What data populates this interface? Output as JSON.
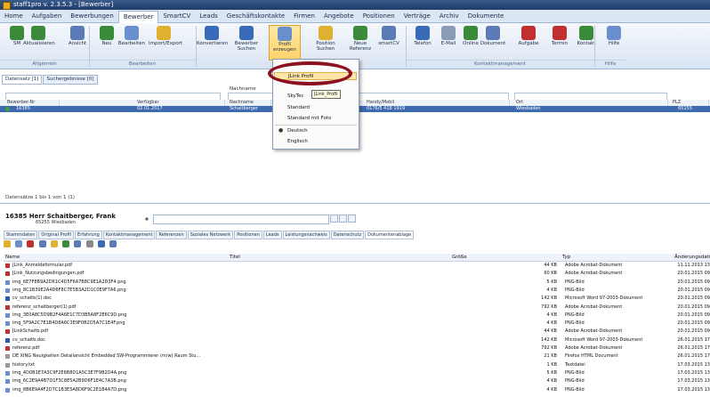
{
  "window": {
    "title": "staff1pro v. 2.3.5.3 - [Bewerber]"
  },
  "menu": [
    "Home",
    "Aufgaben",
    "Bewerbungen",
    "Bewerber",
    "SmartCV",
    "Leads",
    "Geschäftskontakte",
    "Firmen",
    "Angebote",
    "Positionen",
    "Verträge",
    "Archiv",
    "Dokumente"
  ],
  "ribbon": {
    "buttons": [
      "SM",
      "Aktualisieren",
      "Ansicht",
      "Neu",
      "Bearbeiten",
      "Import/Export",
      "Konvertieren",
      "Bewerber Suchen",
      "Profil erzeugen",
      "Position Suchen",
      "Neue Referenz",
      "smartCV",
      "Telefon",
      "E-Mail",
      "Online",
      "Dokument",
      "Aufgabe",
      "Termin",
      "Kontakt",
      "Hilfe"
    ],
    "groups": [
      "Allgemein",
      "Bearbeiten",
      "Kontaktmanagement",
      "Hilfe"
    ]
  },
  "grid": {
    "tabs": [
      "Datensatz [1]",
      "Suchergebnisse [0]"
    ],
    "filter_header": "Nachname",
    "columns": [
      "Bewerber-Nr",
      "Verfügbar",
      "Nachname",
      "Handy/Mobil",
      "Ort",
      "PLZ"
    ],
    "selected_row": [
      "16385",
      "02.01.2017",
      "Schaitberger",
      "0176/5 418 1919",
      "Wiesbaden",
      "65255"
    ],
    "status": "Datensätze 1 bis 1 von 1 (1)"
  },
  "dropdown": {
    "items": [
      "JLink Profil",
      "SkyTec",
      "Standard",
      "Standard mit Foto",
      "Deutsch",
      "Englisch"
    ],
    "tooltip": "JLink_Profil"
  },
  "detail": {
    "name": "16385   Herr Schaitberger, Frank",
    "address": "65255 Wiesbaden",
    "tabs": [
      "Stammdaten",
      "Original Profil",
      "Erfahrung",
      "Kontaktmanagement",
      "Referenzen",
      "Soziales Netzwerk",
      "Positionen",
      "Leads",
      "Leistungsnachweis",
      "Datenschutz",
      "Dokumentenablage"
    ],
    "file_columns": [
      "Name",
      "Titel",
      "Größe",
      "Typ",
      "Änderungsdatum"
    ],
    "files": [
      {
        "name": "JLink_Anmeldeformular.pdf",
        "size": "44 KB",
        "type": "Adobe Acrobat-Dokument",
        "date": "11.11.2013 13"
      },
      {
        "name": "JLink_Nutzungsbedingungen.pdf",
        "size": "60 KB",
        "type": "Adobe Acrobat-Dokument",
        "date": "20.01.2015 09"
      },
      {
        "name": "img_6E7F8B9A2D61C4D5F6A7B8C9E1A2D3F4.png",
        "size": "5 KB",
        "type": "PNG-Bild",
        "date": "20.01.2015 09"
      },
      {
        "name": "img_8C1B39E2A4D6F8C7E5B3A2D1C0E9F7A6.png",
        "size": "4 KB",
        "type": "PNG-Bild",
        "date": "20.01.2015 09"
      },
      {
        "name": "cv_schaitb(1).doc",
        "size": "142 KB",
        "type": "Microsoft Word 97-2003-Dokument",
        "date": "20.01.2015 09"
      },
      {
        "name": "referenz_schaitberger(1).pdf",
        "size": "792 KB",
        "type": "Adobe Acrobat-Dokument",
        "date": "20.01.2015 09"
      },
      {
        "name": "img_3E0A8C5D9B2F4A6E1C7D3B5A8F2E6C9D.png",
        "size": "4 KB",
        "type": "PNG-Bild",
        "date": "20.01.2015 09"
      },
      {
        "name": "img_5F9A2C7E1B4D8A6C3E9F0B2D5A7C1E4F.png",
        "size": "4 KB",
        "type": "PNG-Bild",
        "date": "20.01.2015 09"
      },
      {
        "name": "JLinkSchaitb.pdf",
        "size": "44 KB",
        "type": "Adobe Acrobat-Dokument",
        "date": "20.01.2015 09"
      },
      {
        "name": "cv_schaitb.doc",
        "size": "142 KB",
        "type": "Microsoft Word 97-2003-Dokument",
        "date": "26.01.2015 17"
      },
      {
        "name": "referenz.pdf",
        "size": "792 KB",
        "type": "Adobe Acrobat-Dokument",
        "date": "26.01.2015 17"
      },
      {
        "name": "DE XING Neuigkeiten Detailansicht Embedded SW-Programmierer (m/w) Raum Stu...",
        "size": "21 KB",
        "type": "Firefox HTML Document",
        "date": "26.01.2015 17"
      },
      {
        "name": "history.txt",
        "size": "1 KB",
        "type": "Textdatei",
        "date": "17.03.2015 13"
      },
      {
        "name": "img_4D0B1E7A3C9F2E6B8D1A5C3E7F9B2D4A.png",
        "size": "5 KB",
        "type": "PNG-Bild",
        "date": "17.03.2015 13"
      },
      {
        "name": "img_6C2E9A4B7D1F3C8E5A2B9D6F1E4C7A3B.png",
        "size": "4 KB",
        "type": "PNG-Bild",
        "date": "17.03.2015 13"
      },
      {
        "name": "img_8B6E9A4F2D7C1B3E5A8D6F9C2E1B4A7D.png",
        "size": "4 KB",
        "type": "PNG-Bild",
        "date": "17.03.2015 13"
      }
    ]
  }
}
